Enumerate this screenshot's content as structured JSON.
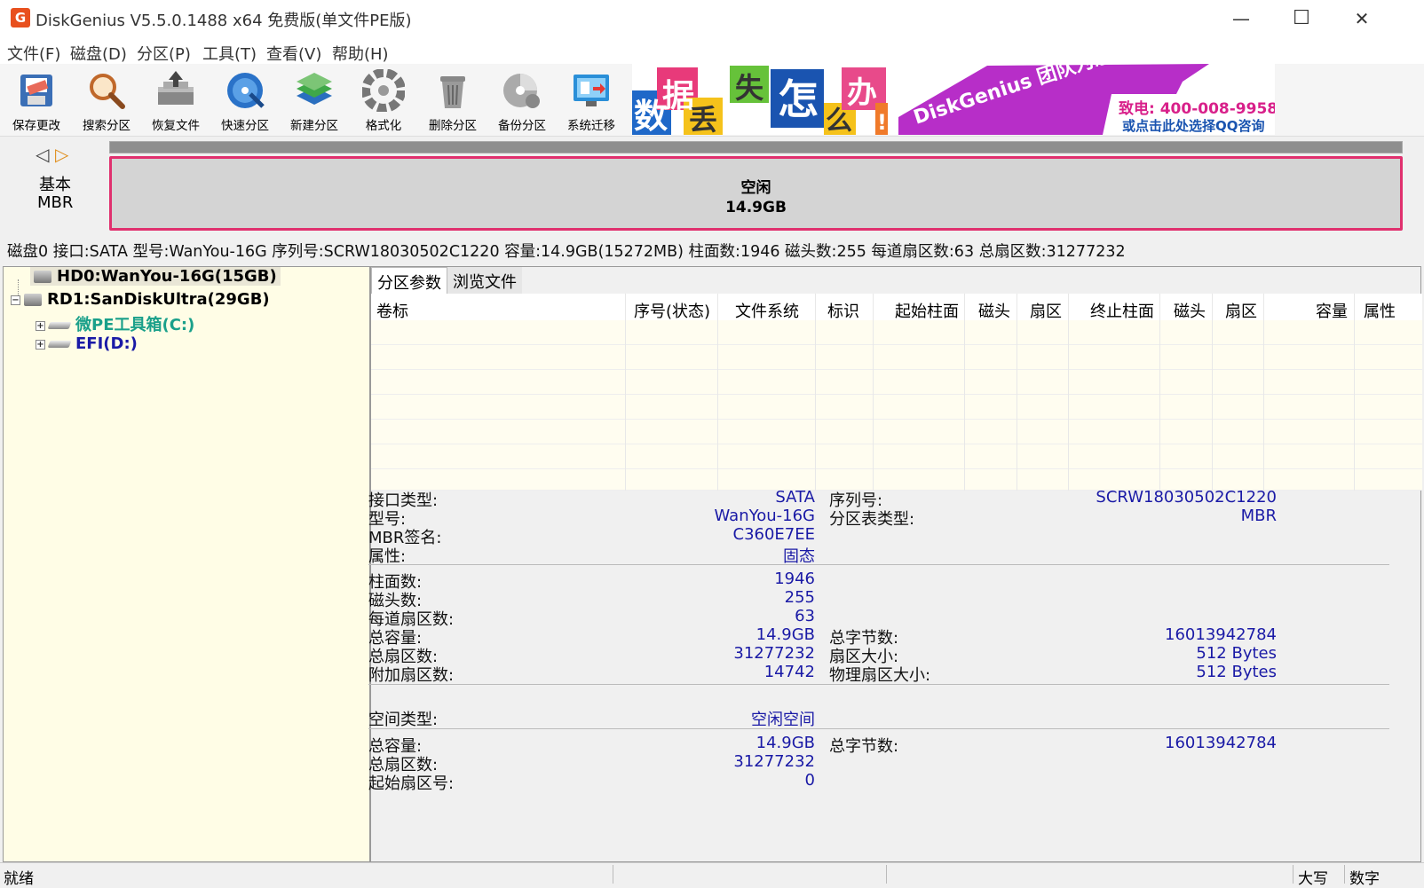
{
  "window": {
    "title": "DiskGenius V5.5.0.1488 x64 免费版(单文件PE版)",
    "app_icon_letter": "G",
    "controls": {
      "minimize": "—",
      "maximize": "☐",
      "close": "✕"
    }
  },
  "menu": [
    "文件(F)",
    "磁盘(D)",
    "分区(P)",
    "工具(T)",
    "查看(V)",
    "帮助(H)"
  ],
  "toolbar": [
    "保存更改",
    "搜索分区",
    "恢复文件",
    "快速分区",
    "新建分区",
    "格式化",
    "删除分区",
    "备份分区",
    "系统迁移"
  ],
  "banner": {
    "chars": [
      "数",
      "据",
      "丢",
      "失",
      "怎",
      "么",
      "办",
      "!"
    ],
    "slogan": "DiskGenius 团队为您服务",
    "phone": "致电: 400-008-9958",
    "qq": "或点击此处选择QQ咨询"
  },
  "diskmap": {
    "nav_left": "◁",
    "nav_right": "▷",
    "type_line1": "基本",
    "type_line2": "MBR",
    "part_label": "空闲",
    "part_size": "14.9GB"
  },
  "infoline": "磁盘0 接口:SATA  型号:WanYou-16G  序列号:SCRW18030502C1220  容量:14.9GB(15272MB)  柱面数:1946  磁头数:255  每道扇区数:63  总扇区数:31277232",
  "tree": {
    "disk0": "HD0:WanYou-16G(15GB)",
    "disk1": "RD1:SanDiskUltra(29GB)",
    "vol_c": "微PE工具箱(C:)",
    "vol_d": "EFI(D:)",
    "expand": "+",
    "collapse": "−"
  },
  "tabs": [
    "分区参数",
    "浏览文件"
  ],
  "columns": [
    "卷标",
    "序号(状态)",
    "文件系统",
    "标识",
    "起始柱面",
    "磁头",
    "扇区",
    "终止柱面",
    "磁头",
    "扇区",
    "容量",
    "属性"
  ],
  "details": {
    "sec1_left": [
      {
        "k": "接口类型:",
        "v": "SATA"
      },
      {
        "k": "型号:",
        "v": "WanYou-16G"
      },
      {
        "k": "MBR签名:",
        "v": "C360E7EE"
      },
      {
        "k": "属性:",
        "v": "固态"
      }
    ],
    "sec1_right": [
      {
        "k": "序列号:",
        "v": "SCRW18030502C1220"
      },
      {
        "k": "分区表类型:",
        "v": "MBR"
      }
    ],
    "sec2_left": [
      {
        "k": "柱面数:",
        "v": "1946"
      },
      {
        "k": "磁头数:",
        "v": "255"
      },
      {
        "k": "每道扇区数:",
        "v": "63"
      },
      {
        "k": "总容量:",
        "v": "14.9GB"
      },
      {
        "k": "总扇区数:",
        "v": "31277232"
      },
      {
        "k": "附加扇区数:",
        "v": "14742"
      }
    ],
    "sec2_right": [
      {
        "k": "总字节数:",
        "v": "16013942784"
      },
      {
        "k": "扇区大小:",
        "v": "512 Bytes"
      },
      {
        "k": "物理扇区大小:",
        "v": "512 Bytes"
      }
    ],
    "space_type": {
      "k": "空间类型:",
      "v": "空闲空间"
    },
    "sec3_left": [
      {
        "k": "总容量:",
        "v": "14.9GB"
      },
      {
        "k": "总扇区数:",
        "v": "31277232"
      },
      {
        "k": "起始扇区号:",
        "v": "0"
      }
    ],
    "sec3_right": [
      {
        "k": "总字节数:",
        "v": "16013942784"
      }
    ]
  },
  "status": {
    "left": "就绪",
    "caps": "大写",
    "num": "数字"
  }
}
